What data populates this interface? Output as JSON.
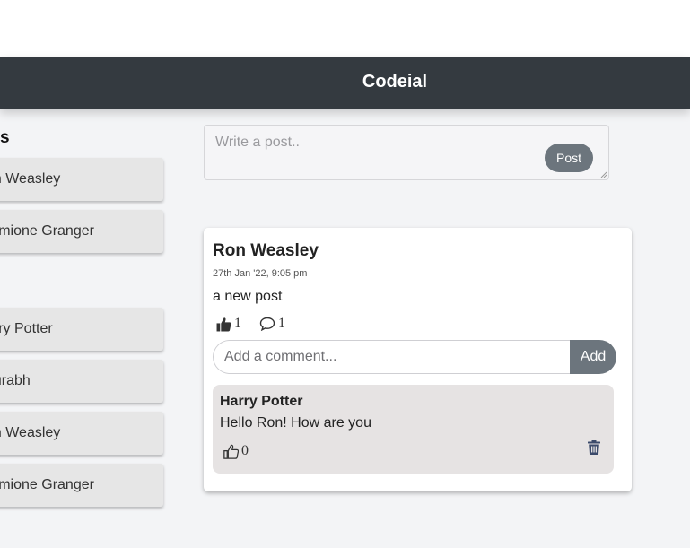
{
  "app": {
    "brand": "Codeial"
  },
  "sidebar": {
    "friends_heading": "s",
    "friends": [
      {
        "name": "on Weasley"
      },
      {
        "name": "ermione Granger"
      }
    ],
    "users": [
      {
        "name": "arry Potter"
      },
      {
        "name": "ourabh"
      },
      {
        "name": "on Weasley"
      },
      {
        "name": "ermione Granger"
      }
    ]
  },
  "post_form": {
    "placeholder": "Write a post..",
    "submit_label": "Post"
  },
  "posts": [
    {
      "author": "Ron Weasley",
      "timestamp": "27th Jan '22, 9:05 pm",
      "content": "a new post",
      "likes": "1",
      "comments_count": "1",
      "comment_form": {
        "placeholder": "Add a comment...",
        "submit_label": "Add"
      },
      "comments": [
        {
          "author": "Harry Potter",
          "text": "Hello Ron! How are you",
          "likes": "0"
        }
      ]
    }
  ],
  "icons": {
    "like_filled": "thumbs-up-solid-icon",
    "comment": "comment-bubble-icon",
    "like_outline": "thumbs-up-outline-icon",
    "delete": "trash-icon"
  },
  "colors": {
    "navbar": "#343a40",
    "button": "#6c757d",
    "comment_bg": "#e6e3e3",
    "trash": "#3b4a6b"
  }
}
